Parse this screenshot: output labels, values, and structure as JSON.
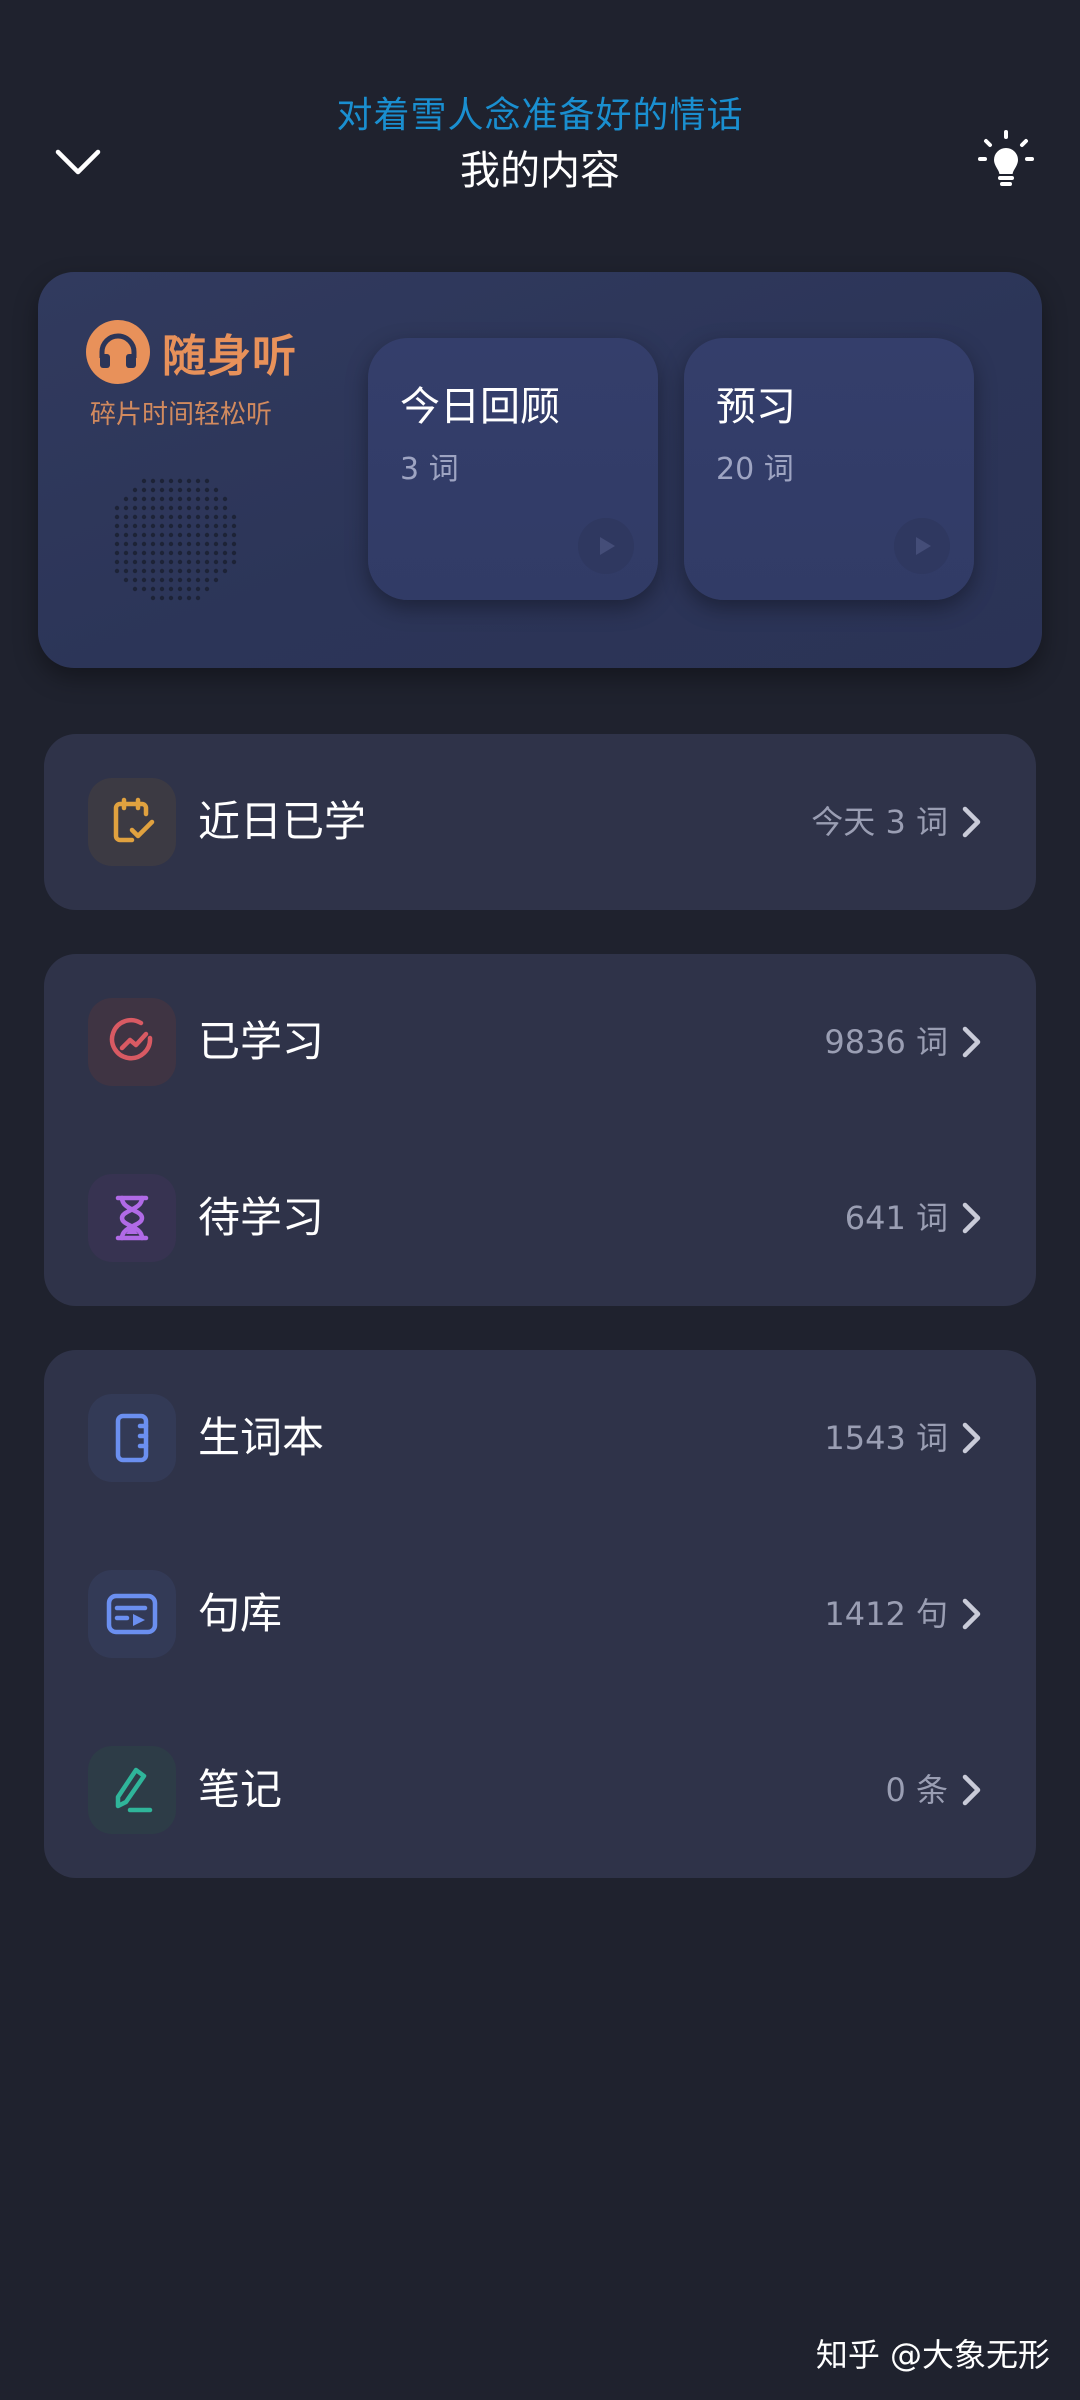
{
  "header": {
    "subtitle": "对着雪人念准备好的情话",
    "title": "我的内容"
  },
  "listen": {
    "brand": "随身听",
    "tagline": "碎片时间轻松听",
    "tiles": [
      {
        "title": "今日回顾",
        "count": "3 词"
      },
      {
        "title": "预习",
        "count": "20 词"
      }
    ]
  },
  "groups": {
    "recent": {
      "label": "近日已学",
      "value": "今天 3 词"
    },
    "learned": {
      "label": "已学习",
      "value": "9836 词"
    },
    "pending": {
      "label": "待学习",
      "value": "641 词"
    },
    "vocab": {
      "label": "生词本",
      "value": "1543 词"
    },
    "sentences": {
      "label": "句库",
      "value": "1412 句"
    },
    "notes": {
      "label": "笔记",
      "value": "0 条"
    }
  },
  "icons": {
    "back": "chevron-down-icon",
    "bulb": "lightbulb-icon",
    "brand": "headphones-icon",
    "recent": "calendar-check-icon",
    "learned": "progress-chart-icon",
    "pending": "hourglass-icon",
    "vocab": "notebook-icon",
    "sentences": "sentence-card-icon",
    "notes": "pencil-icon"
  },
  "colors": {
    "accent_blue": "#1a8fd0",
    "brand_orange": "#e8915a",
    "recent_orange": "#e0a13f",
    "learned_red": "#d95a63",
    "pending_purple": "#b06ae6",
    "vocab_blue": "#6b8ff0",
    "notes_green": "#2fb59a"
  },
  "watermark": "知乎 @大象无形"
}
